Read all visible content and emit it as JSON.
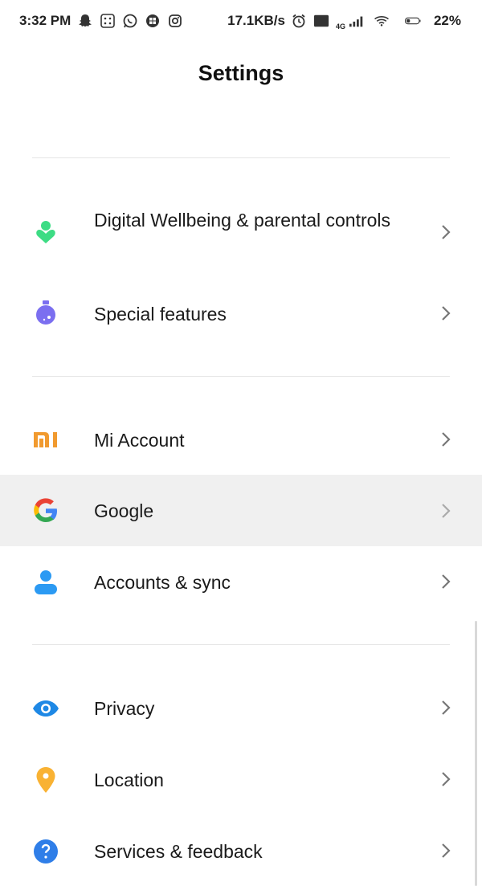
{
  "status_bar": {
    "time": "3:32 PM",
    "speed": "17.1KB/s",
    "network_label": "4G",
    "volte_label": "Vo LTE",
    "battery": "22%",
    "left_icons": [
      "snapchat-icon",
      "notification-grid-icon",
      "whatsapp-icon",
      "app-icon",
      "instagram-icon"
    ],
    "right_icons": [
      "alarm-icon",
      "volte-icon",
      "signal-icon",
      "wifi-icon",
      "battery-icon"
    ]
  },
  "header": {
    "title": "Settings"
  },
  "groups": [
    {
      "items": [
        {
          "label": "Digital Wellbeing & parental controls",
          "icon": "digital-wellbeing-icon",
          "color": "#3ddc84"
        },
        {
          "label": "Special features",
          "icon": "special-features-icon",
          "color": "#7b6ff0"
        }
      ]
    },
    {
      "items": [
        {
          "label": "Mi Account",
          "icon": "mi-logo-icon",
          "color": "#f19a2f"
        },
        {
          "label": "Google",
          "icon": "google-icon",
          "color": "#4285f4"
        },
        {
          "label": "Accounts & sync",
          "icon": "account-icon",
          "color": "#2b9af3"
        }
      ]
    },
    {
      "items": [
        {
          "label": "Privacy",
          "icon": "eye-icon",
          "color": "#1e88e5"
        },
        {
          "label": "Location",
          "icon": "location-pin-icon",
          "color": "#f9b233"
        },
        {
          "label": "Services & feedback",
          "icon": "help-icon",
          "color": "#2f7ee8"
        }
      ]
    }
  ]
}
